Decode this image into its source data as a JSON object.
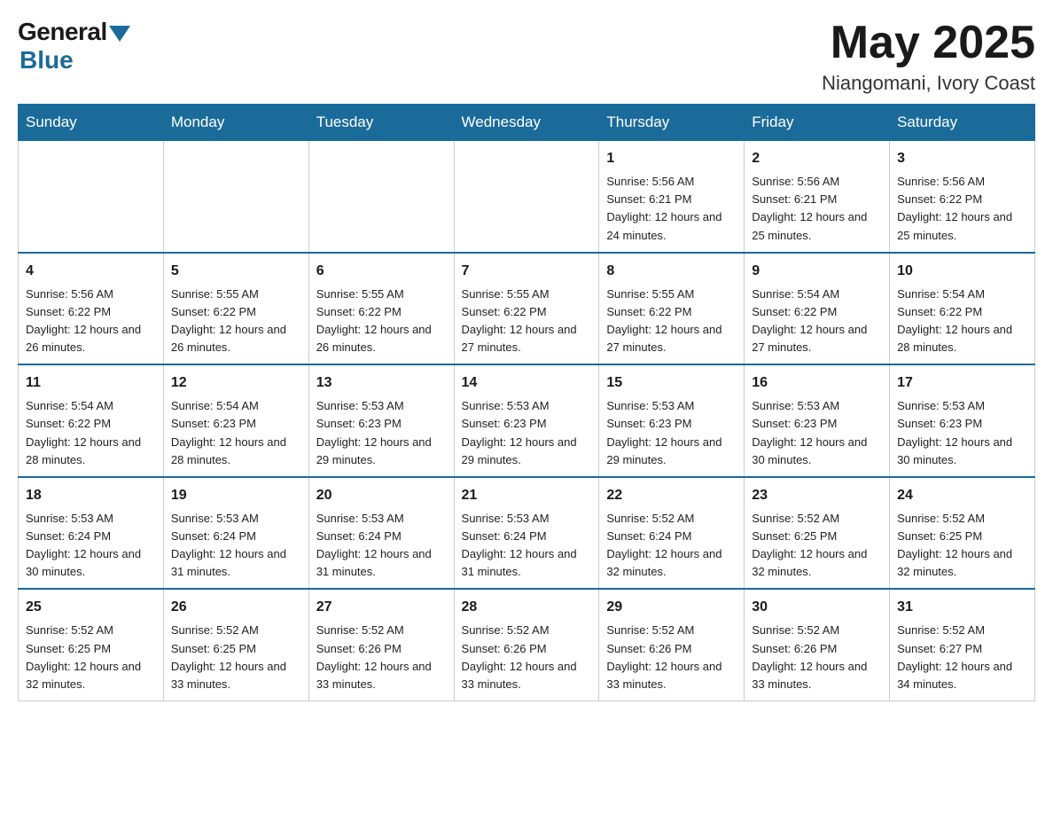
{
  "logo": {
    "general": "General",
    "blue": "Blue"
  },
  "title": "May 2025",
  "location": "Niangomani, Ivory Coast",
  "days_of_week": [
    "Sunday",
    "Monday",
    "Tuesday",
    "Wednesday",
    "Thursday",
    "Friday",
    "Saturday"
  ],
  "weeks": [
    [
      {
        "day": "",
        "info": ""
      },
      {
        "day": "",
        "info": ""
      },
      {
        "day": "",
        "info": ""
      },
      {
        "day": "",
        "info": ""
      },
      {
        "day": "1",
        "info": "Sunrise: 5:56 AM\nSunset: 6:21 PM\nDaylight: 12 hours and 24 minutes."
      },
      {
        "day": "2",
        "info": "Sunrise: 5:56 AM\nSunset: 6:21 PM\nDaylight: 12 hours and 25 minutes."
      },
      {
        "day": "3",
        "info": "Sunrise: 5:56 AM\nSunset: 6:22 PM\nDaylight: 12 hours and 25 minutes."
      }
    ],
    [
      {
        "day": "4",
        "info": "Sunrise: 5:56 AM\nSunset: 6:22 PM\nDaylight: 12 hours and 26 minutes."
      },
      {
        "day": "5",
        "info": "Sunrise: 5:55 AM\nSunset: 6:22 PM\nDaylight: 12 hours and 26 minutes."
      },
      {
        "day": "6",
        "info": "Sunrise: 5:55 AM\nSunset: 6:22 PM\nDaylight: 12 hours and 26 minutes."
      },
      {
        "day": "7",
        "info": "Sunrise: 5:55 AM\nSunset: 6:22 PM\nDaylight: 12 hours and 27 minutes."
      },
      {
        "day": "8",
        "info": "Sunrise: 5:55 AM\nSunset: 6:22 PM\nDaylight: 12 hours and 27 minutes."
      },
      {
        "day": "9",
        "info": "Sunrise: 5:54 AM\nSunset: 6:22 PM\nDaylight: 12 hours and 27 minutes."
      },
      {
        "day": "10",
        "info": "Sunrise: 5:54 AM\nSunset: 6:22 PM\nDaylight: 12 hours and 28 minutes."
      }
    ],
    [
      {
        "day": "11",
        "info": "Sunrise: 5:54 AM\nSunset: 6:22 PM\nDaylight: 12 hours and 28 minutes."
      },
      {
        "day": "12",
        "info": "Sunrise: 5:54 AM\nSunset: 6:23 PM\nDaylight: 12 hours and 28 minutes."
      },
      {
        "day": "13",
        "info": "Sunrise: 5:53 AM\nSunset: 6:23 PM\nDaylight: 12 hours and 29 minutes."
      },
      {
        "day": "14",
        "info": "Sunrise: 5:53 AM\nSunset: 6:23 PM\nDaylight: 12 hours and 29 minutes."
      },
      {
        "day": "15",
        "info": "Sunrise: 5:53 AM\nSunset: 6:23 PM\nDaylight: 12 hours and 29 minutes."
      },
      {
        "day": "16",
        "info": "Sunrise: 5:53 AM\nSunset: 6:23 PM\nDaylight: 12 hours and 30 minutes."
      },
      {
        "day": "17",
        "info": "Sunrise: 5:53 AM\nSunset: 6:23 PM\nDaylight: 12 hours and 30 minutes."
      }
    ],
    [
      {
        "day": "18",
        "info": "Sunrise: 5:53 AM\nSunset: 6:24 PM\nDaylight: 12 hours and 30 minutes."
      },
      {
        "day": "19",
        "info": "Sunrise: 5:53 AM\nSunset: 6:24 PM\nDaylight: 12 hours and 31 minutes."
      },
      {
        "day": "20",
        "info": "Sunrise: 5:53 AM\nSunset: 6:24 PM\nDaylight: 12 hours and 31 minutes."
      },
      {
        "day": "21",
        "info": "Sunrise: 5:53 AM\nSunset: 6:24 PM\nDaylight: 12 hours and 31 minutes."
      },
      {
        "day": "22",
        "info": "Sunrise: 5:52 AM\nSunset: 6:24 PM\nDaylight: 12 hours and 32 minutes."
      },
      {
        "day": "23",
        "info": "Sunrise: 5:52 AM\nSunset: 6:25 PM\nDaylight: 12 hours and 32 minutes."
      },
      {
        "day": "24",
        "info": "Sunrise: 5:52 AM\nSunset: 6:25 PM\nDaylight: 12 hours and 32 minutes."
      }
    ],
    [
      {
        "day": "25",
        "info": "Sunrise: 5:52 AM\nSunset: 6:25 PM\nDaylight: 12 hours and 32 minutes."
      },
      {
        "day": "26",
        "info": "Sunrise: 5:52 AM\nSunset: 6:25 PM\nDaylight: 12 hours and 33 minutes."
      },
      {
        "day": "27",
        "info": "Sunrise: 5:52 AM\nSunset: 6:26 PM\nDaylight: 12 hours and 33 minutes."
      },
      {
        "day": "28",
        "info": "Sunrise: 5:52 AM\nSunset: 6:26 PM\nDaylight: 12 hours and 33 minutes."
      },
      {
        "day": "29",
        "info": "Sunrise: 5:52 AM\nSunset: 6:26 PM\nDaylight: 12 hours and 33 minutes."
      },
      {
        "day": "30",
        "info": "Sunrise: 5:52 AM\nSunset: 6:26 PM\nDaylight: 12 hours and 33 minutes."
      },
      {
        "day": "31",
        "info": "Sunrise: 5:52 AM\nSunset: 6:27 PM\nDaylight: 12 hours and 34 minutes."
      }
    ]
  ]
}
